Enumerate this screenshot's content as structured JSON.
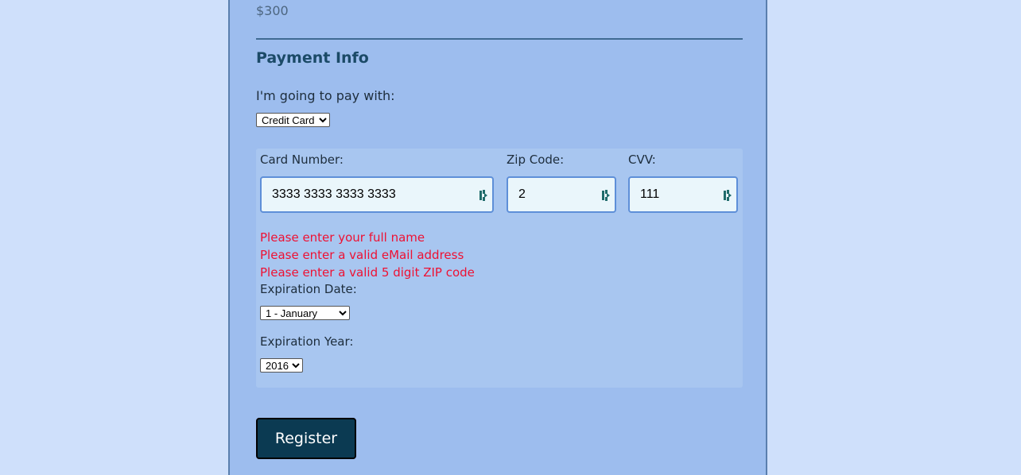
{
  "total": "$300",
  "payment": {
    "title": "Payment Info",
    "pay_with_label": "I'm going to pay with:",
    "pay_with_selected": "Credit Card"
  },
  "card": {
    "number_label": "Card Number:",
    "number_value": "3333 3333 3333 3333",
    "zip_label": "Zip Code:",
    "zip_value": "2",
    "cvv_label": "CVV:",
    "cvv_value": "111"
  },
  "errors": [
    "Please enter your full name",
    "Please enter a valid eMail address",
    "Please enter a valid 5 digit ZIP code"
  ],
  "expiration": {
    "date_label": "Expiration Date:",
    "month_selected": "1 - January",
    "year_label": "Expiration Year:",
    "year_selected": "2016"
  },
  "register_label": "Register",
  "colors": {
    "page_bg": "#cfe0fb",
    "form_bg": "#9dbdee",
    "error": "#ee1133",
    "button_bg": "#0b3a52"
  },
  "icons": {
    "field_icon": "password-manager-icon"
  }
}
